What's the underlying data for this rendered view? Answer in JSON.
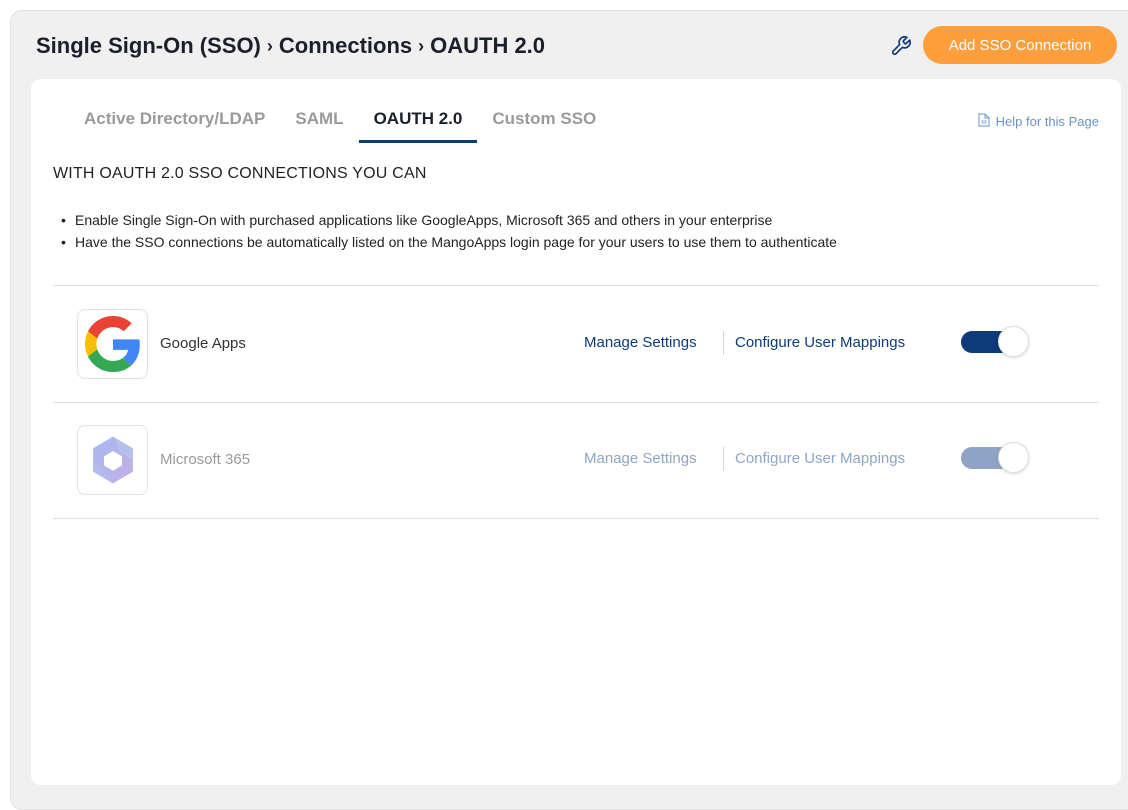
{
  "header": {
    "breadcrumb": [
      "Single Sign-On (SSO)",
      "Connections",
      "OAUTH 2.0"
    ],
    "breadcrumb_separator": "›",
    "add_button_label": "Add SSO Connection",
    "wrench_icon": "wrench-icon"
  },
  "tabs": [
    {
      "label": "Active Directory/LDAP",
      "active": false
    },
    {
      "label": "SAML",
      "active": false
    },
    {
      "label": "OAUTH 2.0",
      "active": true
    },
    {
      "label": "Custom SSO",
      "active": false
    }
  ],
  "help_link": "Help for this Page",
  "section_title": "WITH OAUTH 2.0 SSO CONNECTIONS YOU CAN",
  "bullets": [
    "Enable Single Sign-On with purchased applications like GoogleApps, Microsoft 365 and others in your enterprise",
    "Have the SSO connections be automatically listed on the MangoApps login page for your users to use them to authenticate"
  ],
  "connections": [
    {
      "name": "Google Apps",
      "icon": "google-logo",
      "manage_label": "Manage Settings",
      "mappings_label": "Configure User Mappings",
      "enabled": true
    },
    {
      "name": "Microsoft 365",
      "icon": "microsoft-365-logo",
      "manage_label": "Manage Settings",
      "mappings_label": "Configure User Mappings",
      "enabled": false
    }
  ],
  "colors": {
    "accent_orange": "#ff9e3d",
    "navy": "#0d3a78",
    "disabled_toggle": "#8fa3c6"
  }
}
